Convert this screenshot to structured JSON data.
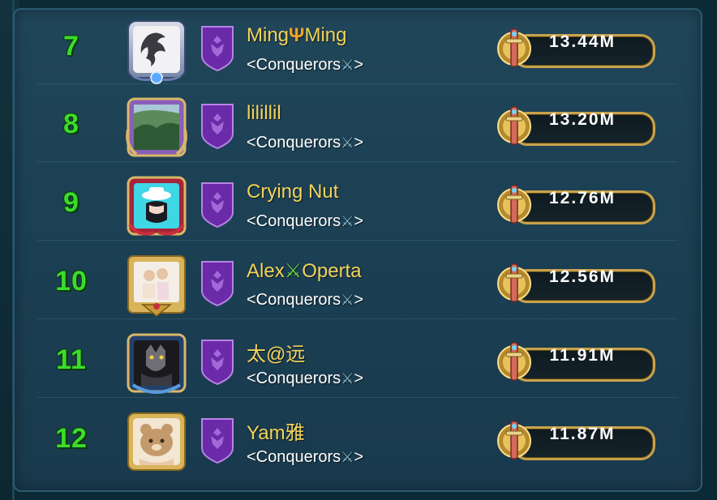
{
  "leaderboard": {
    "rows": [
      {
        "rank": "7",
        "name_parts": [
          "Ming",
          "Ψ",
          "Ming"
        ],
        "guild": "<Conquerors",
        "guild_end": ">",
        "score": "13.44M"
      },
      {
        "rank": "8",
        "name_parts": [
          "lilillil",
          "",
          ""
        ],
        "guild": "<Conquerors",
        "guild_end": ">",
        "score": "13.20M"
      },
      {
        "rank": "9",
        "name_parts": [
          "Crying Nut",
          "",
          ""
        ],
        "guild": "<Conquerors",
        "guild_end": ">",
        "score": "12.76M"
      },
      {
        "rank": "10",
        "name_parts": [
          "Alex",
          "⚔",
          "Operta"
        ],
        "guild": "<Conquerors",
        "guild_end": ">",
        "score": "12.56M"
      },
      {
        "rank": "11",
        "name_parts": [
          "太@远",
          "",
          ""
        ],
        "guild": "<Conquerors",
        "guild_end": ">",
        "score": "11.91M"
      },
      {
        "rank": "12",
        "name_parts": [
          "Yam雅",
          "",
          ""
        ],
        "guild": "<Conquerors",
        "guild_end": ">",
        "score": "11.87M"
      }
    ]
  },
  "icons": {
    "guild_swords": "⚔",
    "score_medal": "sword-medal-icon",
    "guild_banner": "purple-guild-banner-icon"
  },
  "colors": {
    "rank": "#3cdc2a",
    "player_name": "#f2d35a",
    "guild_name": "#ffffff",
    "panel": "#1f4559",
    "score_border": "#c8a24c"
  }
}
